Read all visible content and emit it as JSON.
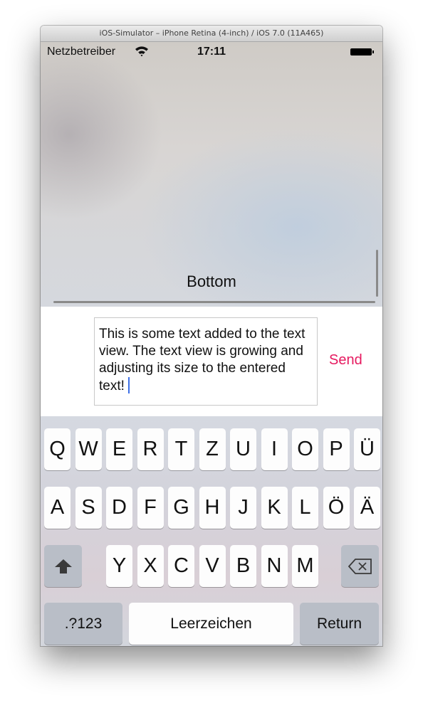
{
  "window": {
    "title": "iOS-Simulator – iPhone Retina (4-inch) / iOS 7.0 (11A465)"
  },
  "status_bar": {
    "carrier": "Netzbetreiber",
    "time": "17:11"
  },
  "content": {
    "label": "Bottom"
  },
  "compose": {
    "text": "This is some text added to the text view. The text view is growing and adjusting its size to the entered text!",
    "send_label": "Send",
    "accent_color": "#e6195f",
    "caret_color": "#3d6fe6"
  },
  "keyboard": {
    "row1": [
      "Q",
      "W",
      "E",
      "R",
      "T",
      "Z",
      "U",
      "I",
      "O",
      "P",
      "Ü"
    ],
    "row2": [
      "A",
      "S",
      "D",
      "F",
      "G",
      "H",
      "J",
      "K",
      "L",
      "Ö",
      "Ä"
    ],
    "row3": [
      "Y",
      "X",
      "C",
      "V",
      "B",
      "N",
      "M"
    ],
    "numbers_label": ".?123",
    "space_label": "Leerzeichen",
    "return_label": "Return"
  }
}
